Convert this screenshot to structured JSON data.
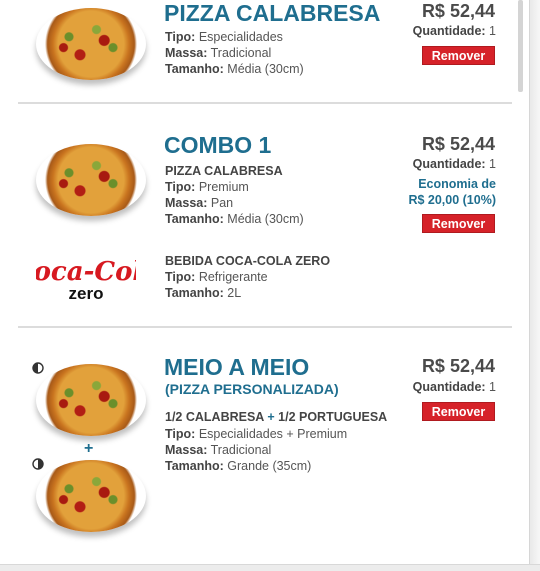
{
  "items": [
    {
      "title": "PIZZA CALABRESA",
      "price": "R$ 52,44",
      "qty_label": "Quantidade:",
      "qty_value": "1",
      "remove_label": "Remover",
      "details": [
        {
          "k": "Tipo:",
          "v": "Especialidades"
        },
        {
          "k": "Massa:",
          "v": "Tradicional"
        },
        {
          "k": "Tamanho:",
          "v": "Média (30cm)"
        }
      ]
    },
    {
      "title": "COMBO 1",
      "price": "R$ 52,44",
      "qty_label": "Quantidade:",
      "qty_value": "1",
      "economy_line1": "Economia de",
      "economy_line2": "R$ 20,00 (10%)",
      "remove_label": "Remover",
      "pizza_name": "PIZZA CALABRESA",
      "pizza_details": [
        {
          "k": "Tipo:",
          "v": "Premium"
        },
        {
          "k": "Massa:",
          "v": "Pan"
        },
        {
          "k": "Tamanho:",
          "v": "Média (30cm)"
        }
      ],
      "drink_logo": "Coca-Cola zero",
      "drink_name": "BEBIDA COCA-COLA ZERO",
      "drink_details": [
        {
          "k": "Tipo:",
          "v": "Refrigerante"
        },
        {
          "k": "Tamanho:",
          "v": "2L"
        }
      ]
    },
    {
      "title": "MEIO A MEIO",
      "subtitle": "(PIZZA PERSONALIZADA)",
      "price": "R$ 52,44",
      "qty_label": "Quantidade:",
      "qty_value": "1",
      "remove_label": "Remover",
      "half1": "1/2 CALABRESA",
      "plus": "+",
      "half2": "1/2 PORTUGUESA",
      "details": [
        {
          "k": "Tipo:",
          "v": "Especialidades + Premium"
        },
        {
          "k": "Massa:",
          "v": "Tradicional"
        },
        {
          "k": "Tamanho:",
          "v": "Grande (35cm)"
        }
      ]
    }
  ],
  "colors": {
    "title": "#1f6e8f",
    "remove": "#d62229"
  },
  "icons": [
    "half-circle-icon",
    "plus-icon"
  ]
}
